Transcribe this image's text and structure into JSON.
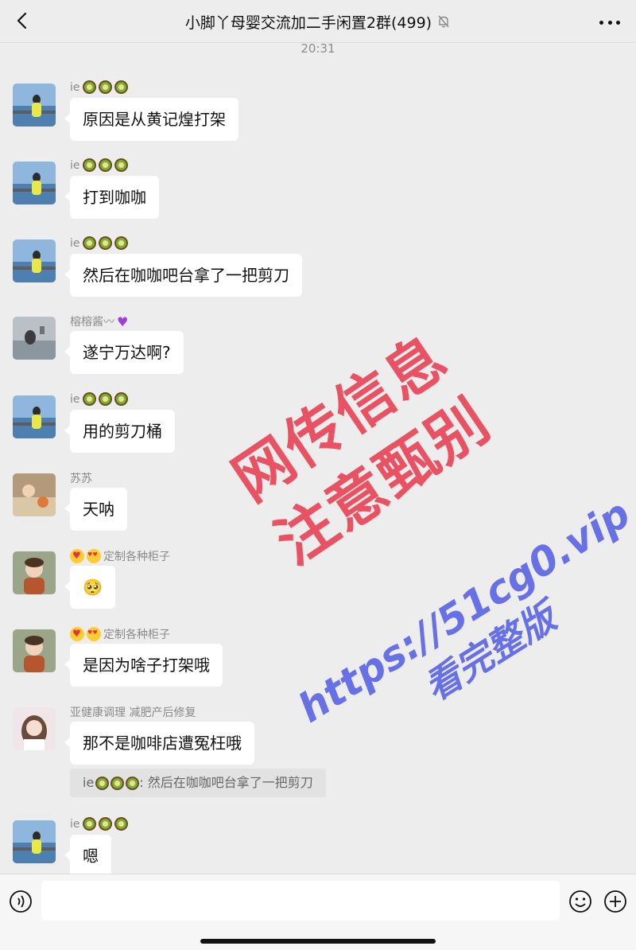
{
  "header": {
    "title": "小脚丫母婴交流加二手闲置2群(499)",
    "back_icon": "chevron-left-icon",
    "mute_icon": "bell-muted-icon",
    "more_icon": "more-dots-icon"
  },
  "timestamp": "20:31",
  "messages": [
    {
      "sender": "ie",
      "text": "原因是从黄记煌打架"
    },
    {
      "sender": "ie",
      "text": "打到咖咖"
    },
    {
      "sender": "ie",
      "text": "然后在咖咖吧台拿了一把剪刀"
    },
    {
      "sender": "榕榕酱〰",
      "text": "遂宁万达啊?"
    },
    {
      "sender": "ie",
      "text": "用的剪刀桶"
    },
    {
      "sender": "苏苏",
      "text": "天呐"
    },
    {
      "sender": "定制各种柜子",
      "text": "🥺"
    },
    {
      "sender": "定制各种柜子",
      "text": "是因为啥子打架哦"
    },
    {
      "sender": "亚健康调理 减肥产后修复",
      "text": "那不是咖啡店遭冤枉哦"
    },
    {
      "sender": "ie",
      "text": "嗯"
    }
  ],
  "quote": {
    "sender": "ie",
    "text": "然后在咖咖吧台拿了一把剪刀"
  },
  "watermarks": {
    "red_line1": "网传信息",
    "red_line2": "注意甄别",
    "blue_url": "https://51cg0.vip",
    "blue_sub": "看完整版"
  },
  "colors": {
    "background": "#ededed",
    "bubble": "#ffffff",
    "red_watermark": "#e8384c",
    "blue_watermark": "#5a63e6"
  },
  "input_bar": {
    "voice_icon": "voice-icon",
    "emoji_icon": "emoji-icon",
    "plus_icon": "plus-icon"
  }
}
